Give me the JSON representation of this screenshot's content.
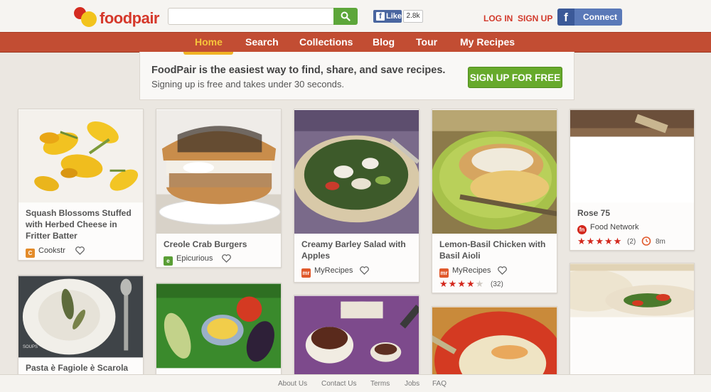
{
  "header": {
    "logo_text": "foodpair",
    "search": {
      "placeholder": "",
      "value": ""
    },
    "fb_like": {
      "label": "Like",
      "count": "2.8k"
    },
    "login": "LOG IN",
    "signup": "SIGN UP",
    "fb_connect": "Connect"
  },
  "nav": {
    "items": [
      "Home",
      "Search",
      "Collections",
      "Blog",
      "Tour",
      "My Recipes"
    ],
    "active": "Home"
  },
  "banner": {
    "headline": "FoodPair is the easiest way to find, share, and save recipes.",
    "subtext": "Signing up is free and takes under 30 seconds.",
    "cta": "SIGN UP FOR FREE"
  },
  "recipes": [
    {
      "title_lines": [
        "Squash Blossoms Stuffed",
        "with Herbed Cheese in",
        "Fritter Batter"
      ],
      "source": "Cookstr",
      "source_icon": "cookstr-icon",
      "source_color": "#e38b2a"
    },
    {
      "title_lines": [
        "Creole Crab Burgers"
      ],
      "source": "Epicurious",
      "source_icon": "epicurious-icon",
      "source_color": "#5a9e35"
    },
    {
      "title_lines": [
        "Creamy Barley Salad with",
        "Apples"
      ],
      "source": "MyRecipes",
      "source_icon": "myrecipes-icon",
      "source_color": "#e0592b"
    },
    {
      "title_lines": [
        "Lemon-Basil Chicken with",
        "Basil Aioli"
      ],
      "source": "MyRecipes",
      "source_icon": "myrecipes-icon",
      "source_color": "#e0592b",
      "rating": 4,
      "rating_count": "(32)"
    },
    {
      "title_lines": [
        "Rose 75"
      ],
      "source": "Food Network",
      "source_icon": "food-network-icon",
      "source_color": "#d3271c",
      "rating": 5,
      "rating_count": "(2)",
      "time": "8m"
    },
    {
      "title_lines": [
        "Pasta è Fagiole è Scarola"
      ],
      "image_badge": "SOUPS"
    }
  ],
  "footer": {
    "links": [
      "About Us",
      "Contact Us",
      "Terms",
      "Jobs",
      "FAQ"
    ]
  },
  "colors": {
    "brand_red": "#c24d33",
    "nav_active": "#f6c43b",
    "cta_green": "#67aa2c",
    "star_red": "#d3271c",
    "facebook_blue": "#3b5998"
  }
}
